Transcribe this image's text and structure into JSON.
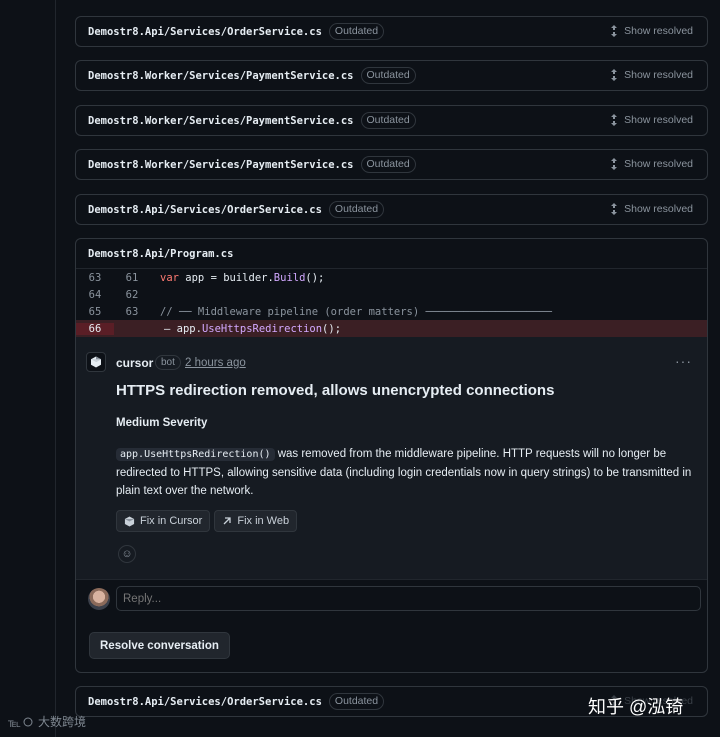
{
  "files": [
    {
      "path": "Demostr8.Api/Services/OrderService.cs",
      "badge": "Outdated",
      "action": "Show resolved"
    },
    {
      "path": "Demostr8.Worker/Services/PaymentService.cs",
      "badge": "Outdated",
      "action": "Show resolved"
    },
    {
      "path": "Demostr8.Worker/Services/PaymentService.cs",
      "badge": "Outdated",
      "action": "Show resolved"
    },
    {
      "path": "Demostr8.Worker/Services/PaymentService.cs",
      "badge": "Outdated",
      "action": "Show resolved"
    },
    {
      "path": "Demostr8.Api/Services/OrderService.cs",
      "badge": "Outdated",
      "action": "Show resolved"
    }
  ],
  "thread": {
    "file_path": "Demostr8.Api/Program.cs",
    "diff": [
      {
        "old": "63",
        "new": "61",
        "kw": "var",
        "text": " app = builder.",
        "fn": "Build",
        "tail": "();"
      },
      {
        "old": "64",
        "new": "62",
        "text": ""
      },
      {
        "old": "65",
        "new": "63",
        "comment": "// ── Middleware pipeline (order matters) ────────────────────"
      },
      {
        "old": "66",
        "new": "",
        "marker": "–",
        "text": " app.",
        "fn": "UseHttpsRedirection",
        "tail": "();"
      }
    ],
    "comment": {
      "author": "cursor",
      "badge": "bot",
      "time": "2 hours ago",
      "title": "HTTPS redirection removed, allows unencrypted connections",
      "severity": "Medium Severity",
      "code": "app.UseHttpsRedirection()",
      "body": " was removed from the middleware pipeline. HTTP requests will no longer be redirected to HTTPS, allowing sensitive data (including login credentials now in query strings) to be transmitted in plain text over the network.",
      "buttons": [
        "Fix in Cursor",
        "Fix in Web"
      ]
    },
    "reply_placeholder": "Reply...",
    "resolve_label": "Resolve conversation"
  },
  "bottom_file": {
    "path": "Demostr8.Api/Services/OrderService.cs",
    "badge": "Outdated",
    "action": "Show resolved"
  },
  "watermark_left": "大数跨境",
  "watermark_right": "知乎 @泓锜"
}
